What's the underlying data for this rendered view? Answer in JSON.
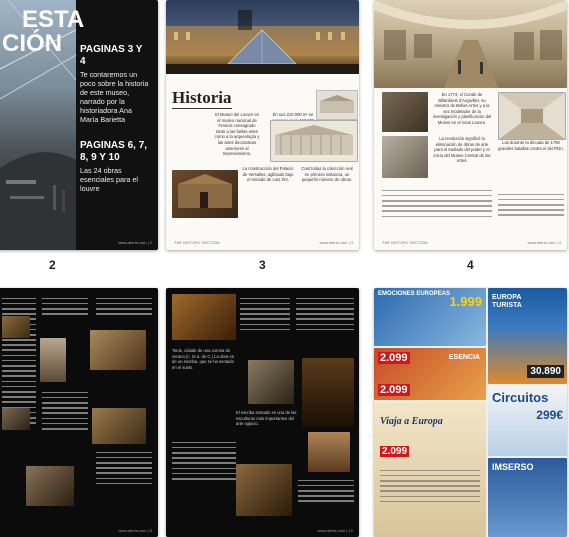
{
  "pages": {
    "p2": {
      "overlay_title_1": "ESTA",
      "overlay_title_2": "CIÓN",
      "heading_1": "PAGINAS 3 Y 4",
      "text_1": "Te contaremos un poco sobre la historia de este museo, narrado por la historiadora Ana María Barietta",
      "heading_2": "PAGINAS 6, 7, 8, 9 Y 10",
      "text_2": "Las 24 obras esenciales para el louvre",
      "footer": "www.alerts.com  |  2",
      "number": "2"
    },
    "p3": {
      "section_title": "Historia",
      "intro": "El Museo del Louvre es el museo nacional de Francia consagrado tanto a las bellas artes como a la arqueología y las artes decorativas anteriores al Impresionismo.",
      "col2": "En sus 210 000 m² se exponen unas 467 000 obras, de las cuales 7000 son pinturas, y unos 30 000 objetos y antigüedades.",
      "col3": "La construcción del Palacio de Versalles, agilizado bajo el reinado de Luis XIV.",
      "col4": "Cast todas la colección real en primera instancia, un pequeño número de obras.",
      "footer_left": "THE HISTORY SECTION",
      "footer_right": "www.alerts.com  |  3",
      "number": "3"
    },
    "p4": {
      "col1": "En 1774, el Conde de Billardierie d'Angiviller, su ministro de Bellas Artes y a la vez modelador de la investigación y planificación del Museo en el Gran Louvre.",
      "col2": "La revolución significó la eliminación de obras de arte para el traslado del poder y el inicio del Museo Central de las Artes.",
      "col3": "Las durante la década de 1790 grandes batallas contra el del Rhin.",
      "footer_left": "THE HISTORY SECTION",
      "footer_right": "www.alerts.com  |  4",
      "number": "4"
    },
    "p5": {
      "footer": "www.alerts.com  |  5"
    },
    "p6": {
      "col1": "Tanis, cidade de una corona de verano (c. IX a. de C.) La obra es de un escriba, que se ha sentado en el suelo.",
      "col2": "El escriba sentado es una de las esculturas más importantes del arte egipcio.",
      "footer": "www.alerts.com  |  10"
    },
    "p7": {
      "banners": {
        "europa_title": "EMOCIONES EUROPEAS",
        "price_1": "1.999",
        "europa_turista": "EUROPA TURISTA",
        "price_2": "30.890",
        "price_3": "2.099",
        "price_4": "2.099",
        "esencia": "ESENCIA",
        "circuitos": "Circuitos",
        "price_5": "299€",
        "viaja": "Viaja a Europa",
        "imserso": "IMSERSO",
        "price_6": "2.099"
      }
    }
  }
}
